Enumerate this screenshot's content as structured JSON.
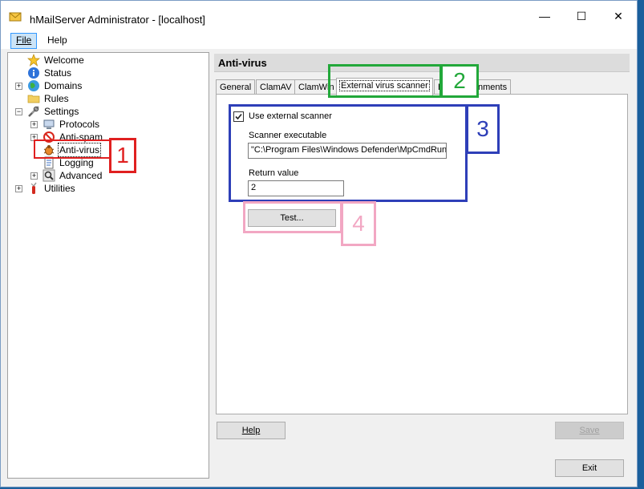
{
  "window": {
    "title": "hMailServer Administrator - [localhost]",
    "controls": {
      "minimize": "—",
      "maximize": "☐",
      "close": "✕"
    }
  },
  "menu": {
    "items": [
      {
        "label": "File"
      },
      {
        "label": "Help"
      }
    ]
  },
  "tree": {
    "items": [
      {
        "label": "Welcome",
        "icon": "star-icon"
      },
      {
        "label": "Status",
        "icon": "info-icon"
      },
      {
        "label": "Domains",
        "icon": "globe-icon"
      },
      {
        "label": "Rules",
        "icon": "folder-icon"
      },
      {
        "label": "Settings",
        "icon": "tools-icon"
      },
      {
        "label": "Protocols",
        "icon": "computer-icon"
      },
      {
        "label": "Anti-spam",
        "icon": "no-entry-icon"
      },
      {
        "label": "Anti-virus",
        "icon": "bug-icon"
      },
      {
        "label": "Logging",
        "icon": "document-icon"
      },
      {
        "label": "Advanced",
        "icon": "magnifier-icon"
      },
      {
        "label": "Utilities",
        "icon": "swiss-knife-icon"
      }
    ]
  },
  "content": {
    "header": "Anti-virus",
    "tabs": [
      {
        "label": "General"
      },
      {
        "label": "ClamAV"
      },
      {
        "label": "ClamWin"
      },
      {
        "label": "External virus scanner"
      },
      {
        "label": "B"
      },
      {
        "label": "nments"
      }
    ],
    "use_external_scanner": {
      "label": "Use external scanner",
      "checked": true
    },
    "scanner_executable": {
      "label": "Scanner executable",
      "value": "\"C:\\Program Files\\Windows Defender\\MpCmdRun"
    },
    "return_value": {
      "label": "Return value",
      "value": "2"
    },
    "test_button": "Test...",
    "help_button": "Help",
    "save_button": "Save",
    "exit_button": "Exit"
  },
  "annotations": [
    {
      "number": "1",
      "color": "#e02020"
    },
    {
      "number": "2",
      "color": "#22a83a"
    },
    {
      "number": "3",
      "color": "#2e3fb8"
    },
    {
      "number": "4",
      "color": "#f2a7c3"
    }
  ]
}
